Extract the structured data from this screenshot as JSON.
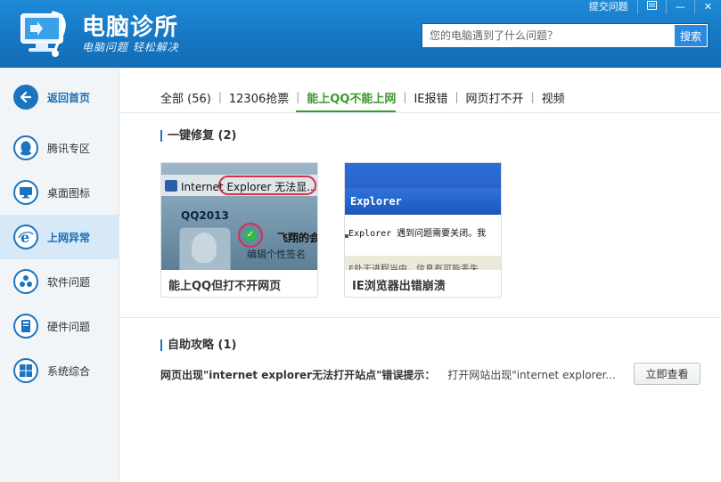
{
  "header": {
    "app_title": "电脑诊所",
    "app_slogan": "电脑问题 轻松解决",
    "topbar": {
      "submit_label": "提交问题",
      "menu_icon": "menu-icon",
      "minimize_label": "—",
      "close_label": "✕"
    },
    "search": {
      "placeholder": "您的电脑遇到了什么问题？",
      "button_label": "搜索"
    }
  },
  "sidebar": {
    "items": [
      {
        "label": "返回首页",
        "icon": "back-arrow-icon"
      },
      {
        "label": "腾讯专区",
        "icon": "qq-penguin-icon"
      },
      {
        "label": "桌面图标",
        "icon": "monitor-icon"
      },
      {
        "label": "上网异常",
        "icon": "ie-browser-icon"
      },
      {
        "label": "软件问题",
        "icon": "software-icon"
      },
      {
        "label": "硬件问题",
        "icon": "hardware-icon"
      },
      {
        "label": "系统综合",
        "icon": "windows-icon"
      }
    ],
    "active_index": 3
  },
  "tabs": {
    "items": [
      {
        "label": "全部 (56)"
      },
      {
        "label": "12306抢票"
      },
      {
        "label": "能上QQ不能上网"
      },
      {
        "label": "IE报错"
      },
      {
        "label": "网页打不开"
      },
      {
        "label": "视频"
      }
    ],
    "active_index": 2
  },
  "fix_section": {
    "title": "一键修复 (2)",
    "cards": [
      {
        "caption": "能上QQ但打不开网页",
        "thumb": {
          "bar_text": "Internet Explorer 无法显...",
          "qq_label": "QQ2013",
          "name_text": "飞翔的会",
          "signature_text": "编辑个性签名"
        }
      },
      {
        "caption": "IE浏览器出错崩溃",
        "thumb": {
          "title_text": "Explorer",
          "line1_text": "Explorer 遇到问题需要关闭。我",
          "line2_text": "F处于进程当中，信息有可能丢失"
        }
      }
    ]
  },
  "guide_section": {
    "title": "自助攻略 (1)",
    "items": [
      {
        "title": "网页出现\"internet explorer无法打开站点\"错误提示：",
        "desc": "打开网站出现\"internet explorer...",
        "button_label": "立即查看"
      }
    ]
  },
  "colors": {
    "header_blue": "#1677c4",
    "accent_green": "#3a9a2a",
    "sidebar_active": "#d7e9f7",
    "icon_blue": "#1a74bf"
  }
}
